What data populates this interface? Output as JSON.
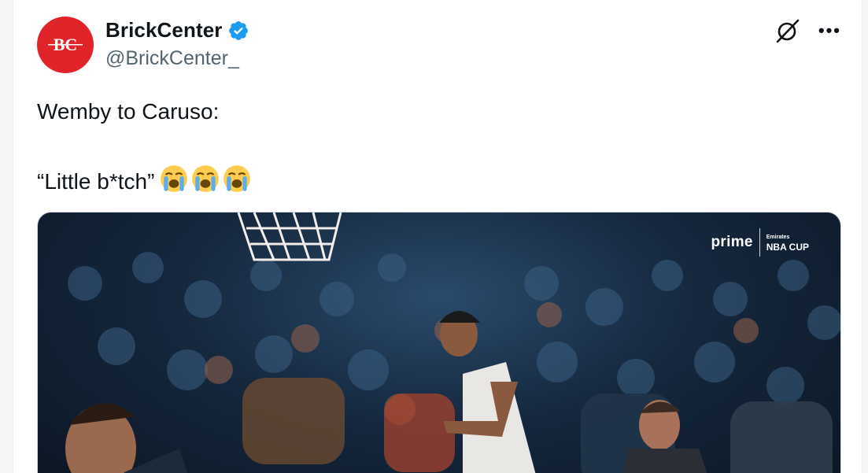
{
  "tweet": {
    "display_name": "BrickCenter",
    "handle": "@BrickCenter_",
    "avatar_text": "BC",
    "text_line1": "Wemby to Caruso:",
    "text_line2": "“Little b*tch”",
    "emojis": [
      "loudly-crying-face",
      "loudly-crying-face",
      "loudly-crying-face"
    ]
  },
  "icons": {
    "verified": "verified-badge-icon",
    "grok": "grok-icon",
    "more": "more-options-icon"
  },
  "media": {
    "watermark_prime": "prime",
    "watermark_cup_small": "Emirates",
    "watermark_cup": "NBA CUP"
  },
  "colors": {
    "verified_blue": "#1d9bf0",
    "avatar_red": "#e0242a",
    "handle_gray": "#536471"
  }
}
